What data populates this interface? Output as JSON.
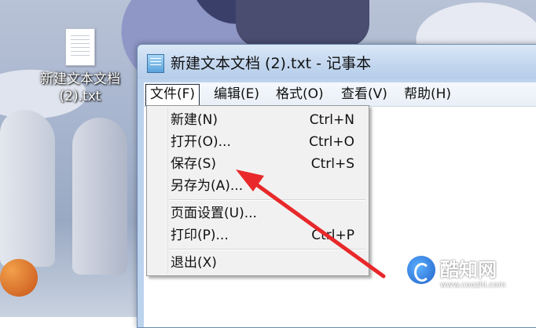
{
  "desktop": {
    "icon_label_line1": "新建文本文档",
    "icon_label_line2": "(2).txt"
  },
  "window": {
    "title": "新建文本文档 (2).txt - 记事本"
  },
  "menubar": {
    "file": "文件(F)",
    "edit": "编辑(E)",
    "format": "格式(O)",
    "view": "查看(V)",
    "help": "帮助(H)"
  },
  "file_menu": {
    "new": {
      "label": "新建(N)",
      "shortcut": "Ctrl+N"
    },
    "open": {
      "label": "打开(O)...",
      "shortcut": "Ctrl+O"
    },
    "save": {
      "label": "保存(S)",
      "shortcut": "Ctrl+S"
    },
    "save_as": {
      "label": "另存为(A)..."
    },
    "page_setup": {
      "label": "页面设置(U)..."
    },
    "print": {
      "label": "打印(P)...",
      "shortcut": "Ctrl+P"
    },
    "exit": {
      "label": "退出(X)"
    }
  },
  "watermark": {
    "name": "酷知网",
    "url": "www.coozhi.com"
  },
  "colors": {
    "annotation_arrow": "#e8282a"
  }
}
